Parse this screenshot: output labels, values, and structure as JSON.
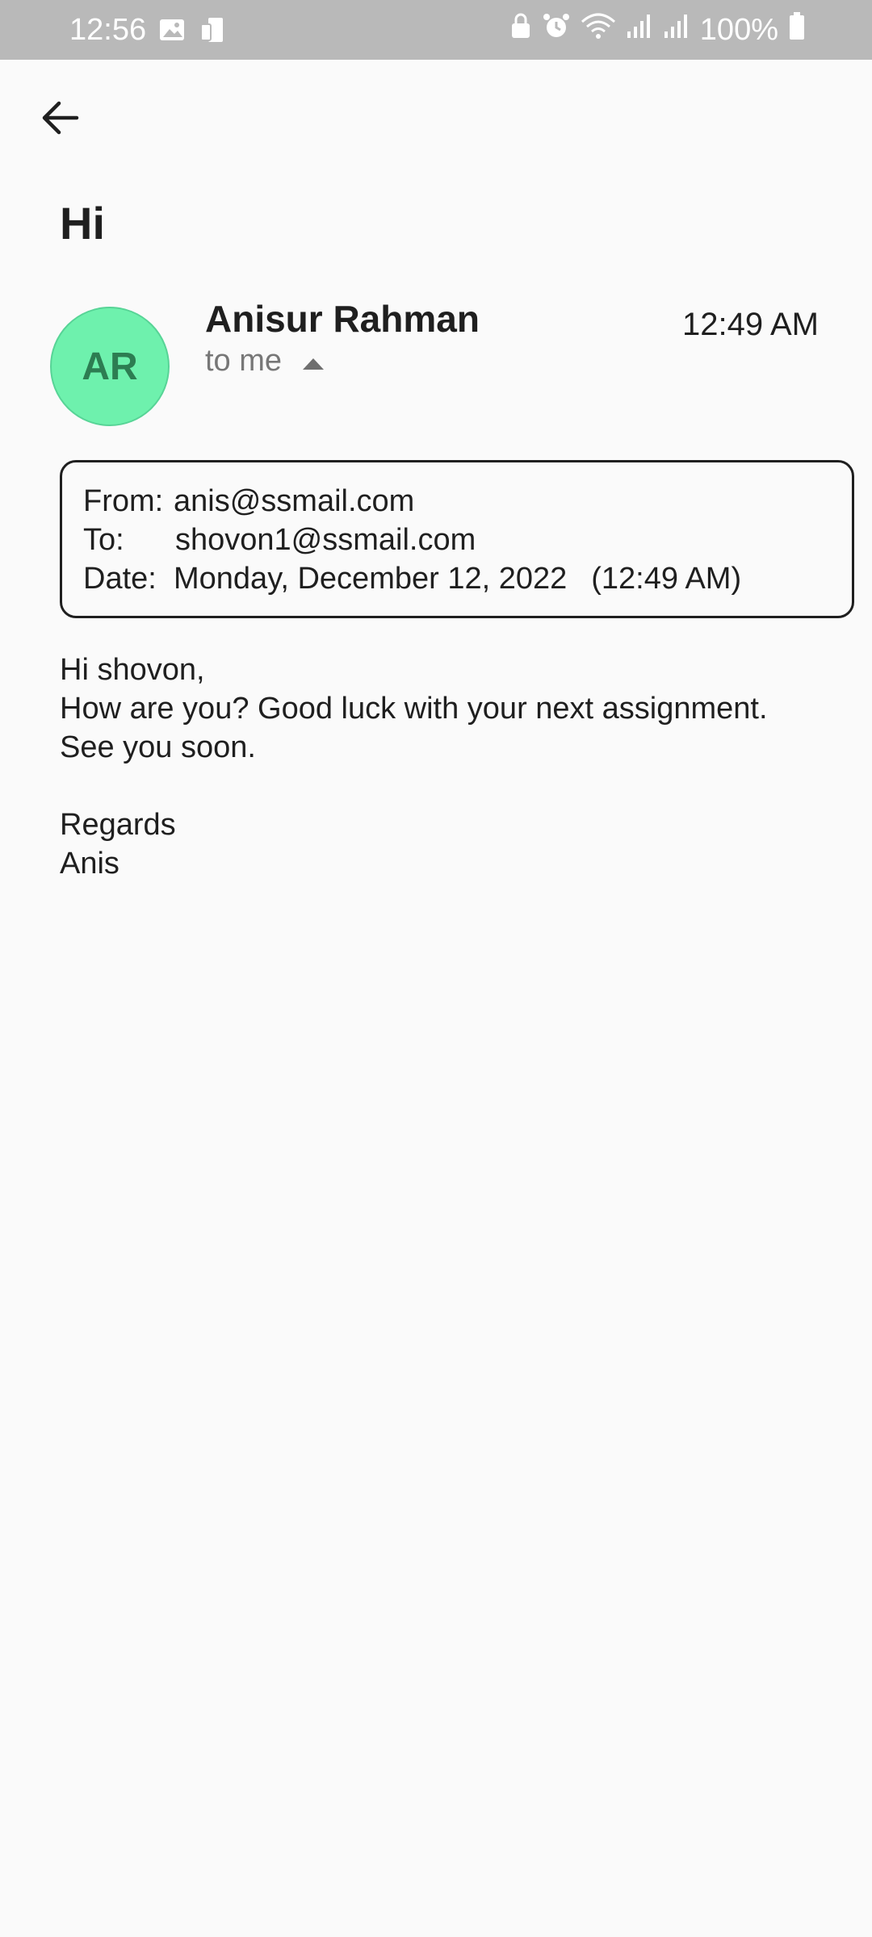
{
  "status_bar": {
    "time": "12:56",
    "battery": "100%",
    "left_icons": [
      "gallery-icon",
      "device-icon"
    ],
    "right_icons": [
      "lock-icon",
      "alarm-icon",
      "wifi-icon",
      "signal-icon",
      "signal-icon",
      "battery-icon"
    ]
  },
  "email": {
    "subject": "Hi",
    "avatar_initials": "AR",
    "avatar_color": "#6ef1ad",
    "sender_name": "Anisur Rahman",
    "recipient_summary": "to me",
    "time": "12:49 AM",
    "details": {
      "from_label": "From:",
      "from_value": "anis@ssmail.com",
      "to_label": "To:",
      "to_value": "shovon1@ssmail.com",
      "date_label": "Date:",
      "date_value": "Monday, December 12, 2022",
      "time_value": "(12:49 AM)"
    },
    "body": {
      "line1": "Hi shovon,",
      "line2": "How are you? Good luck with your next assignment.",
      "line3": "See you soon.",
      "line5": "Regards",
      "line6": "Anis"
    }
  }
}
